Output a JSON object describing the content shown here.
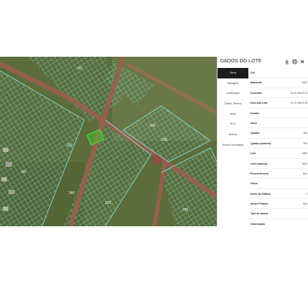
{
  "panel": {
    "title": "DADOS DO LOTE",
    "icons": [
      "print-icon",
      "download-icon",
      "close-icon"
    ]
  },
  "tabs": [
    {
      "label": "Geral",
      "active": true
    },
    {
      "label": "Metragem",
      "active": false
    },
    {
      "label": "Localização",
      "active": false
    },
    {
      "label": "Caract. Terreno",
      "active": false
    },
    {
      "label": "IPDU",
      "active": false
    },
    {
      "label": "IPTU",
      "active": false
    },
    {
      "label": "Anexos",
      "active": false
    },
    {
      "label": "Novos Formulários",
      "active": false
    }
  ],
  "fields": [
    {
      "label": "CAI",
      "value": ""
    },
    {
      "label": "Matrícula",
      "value": "5082"
    },
    {
      "label": "Inscrição",
      "value": "01.01.256.0178"
    },
    {
      "label": "Inscrição Lote",
      "value": "01.01.256.0178"
    },
    {
      "label": "Distrito",
      "value": ""
    },
    {
      "label": "Setor",
      "value": ""
    },
    {
      "label": "Quadra",
      "value": "256"
    },
    {
      "label": "Quadra (cartório)",
      "value": "256"
    },
    {
      "label": "Lote",
      "value": "0082"
    },
    {
      "label": "Lote (cartório)",
      "value": "0082"
    },
    {
      "label": "Possui Anexos",
      "value": "Não"
    },
    {
      "label": "Ofício",
      "value": ""
    },
    {
      "label": "Nome do Edifício",
      "value": "0"
    },
    {
      "label": "Imóvel Público",
      "value": "Não"
    },
    {
      "label": "Tipo de Imóvel",
      "value": ""
    },
    {
      "label": "Observação",
      "value": ""
    }
  ],
  "map": {
    "labels": [
      "3/2",
      "3/8",
      "220",
      "240",
      "223",
      "233",
      "239",
      "223"
    ],
    "colors": {
      "parcel": "#7fe8df",
      "road": "#9a5f4f",
      "selected": "#39e82b"
    }
  }
}
